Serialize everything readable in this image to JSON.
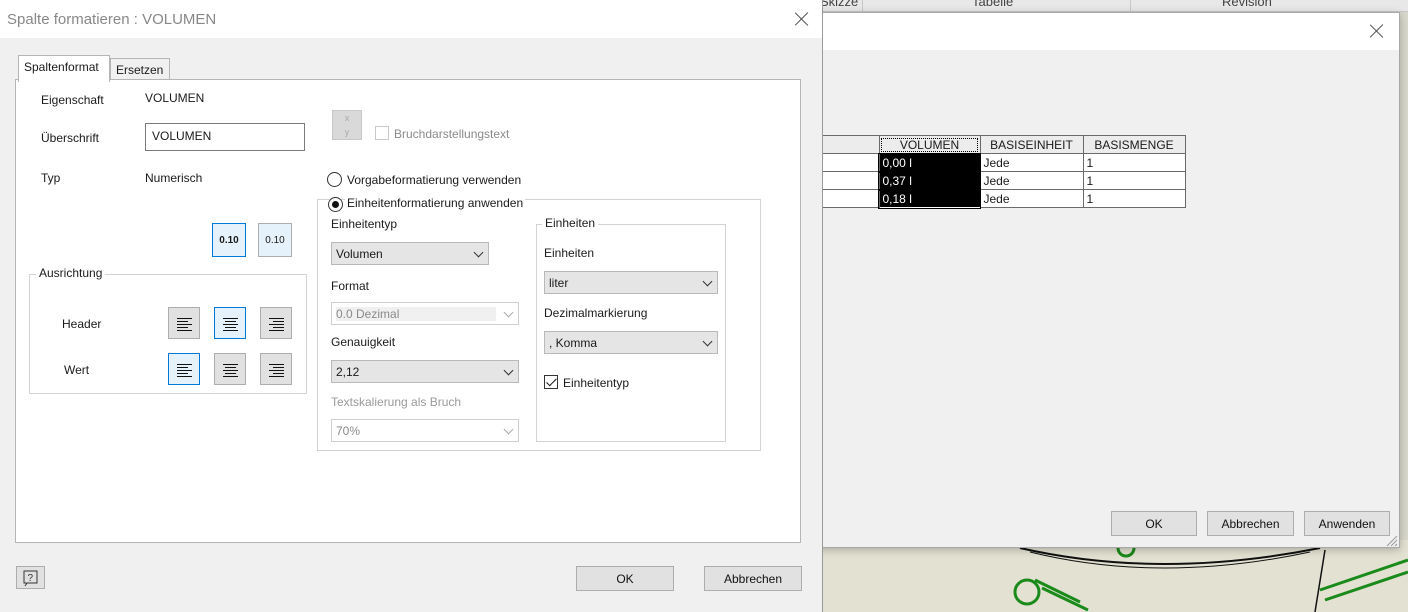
{
  "background": {
    "header_columns": [
      "Skizze",
      "Tabelle",
      "Revision"
    ]
  },
  "back_dialog": {
    "table": {
      "headers": [
        "VOLUMEN",
        "BASISEINHEIT",
        "BASISMENGE"
      ],
      "rows": [
        [
          "0,00 l",
          "Jede",
          "1"
        ],
        [
          "0,37 l",
          "Jede",
          "1"
        ],
        [
          "0,18 l",
          "Jede",
          "1"
        ]
      ]
    },
    "buttons": {
      "ok": "OK",
      "cancel": "Abbrechen",
      "apply": "Anwenden"
    }
  },
  "dialog": {
    "title": "Spalte formatieren : VOLUMEN",
    "tabs": [
      "Spaltenformat",
      "Ersetzen"
    ],
    "property": {
      "label": "Eigenschaft",
      "value": "VOLUMEN"
    },
    "heading": {
      "label": "Überschrift",
      "value": "VOLUMEN"
    },
    "type": {
      "label": "Typ",
      "value": "Numerisch"
    },
    "number_format_buttons": [
      "0.10",
      "0.10"
    ],
    "fraction_text_label": "Bruchdarstellungstext",
    "alignment": {
      "title": "Ausrichtung",
      "header_label": "Header",
      "value_label": "Wert"
    },
    "radio_default": "Vorgabeformatierung verwenden",
    "radio_units": "Einheitenformatierung anwenden",
    "unit_type": {
      "label": "Einheitentyp",
      "value": "Volumen"
    },
    "format": {
      "label": "Format",
      "value": "0.0 Dezimal"
    },
    "precision": {
      "label": "Genauigkeit",
      "value": "2,12"
    },
    "text_scale": {
      "label": "Textskalierung als Bruch",
      "value": "70%"
    },
    "units_group": {
      "title": "Einheiten",
      "units_label": "Einheiten",
      "units_value": "liter",
      "decimal_label": "Dezimalmarkierung",
      "decimal_value": ", Komma",
      "unit_type_check_label": "Einheitentyp"
    },
    "buttons": {
      "ok": "OK",
      "cancel": "Abbrechen"
    }
  },
  "colors": {
    "accent": "#0078d7",
    "drawing_green": "#1a8a1a"
  }
}
